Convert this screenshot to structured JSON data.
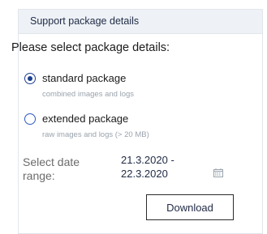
{
  "panel": {
    "title": "Support package details"
  },
  "form": {
    "section_title": "Please select package details:",
    "options": [
      {
        "label": "standard package",
        "description": "combined images and logs",
        "selected": true
      },
      {
        "label": "extended package",
        "description": "raw images and logs (> 20 MB)",
        "selected": false
      }
    ],
    "date_range": {
      "label": "Select date range:",
      "value_start": "21.3.2020 -",
      "value_end": "22.3.2020",
      "icon": "calendar-icon"
    },
    "download_label": "Download"
  },
  "colors": {
    "header_bg": "#eef2f7",
    "radio_accent": "#1d3f8f",
    "muted_text": "#9aa3ad"
  }
}
